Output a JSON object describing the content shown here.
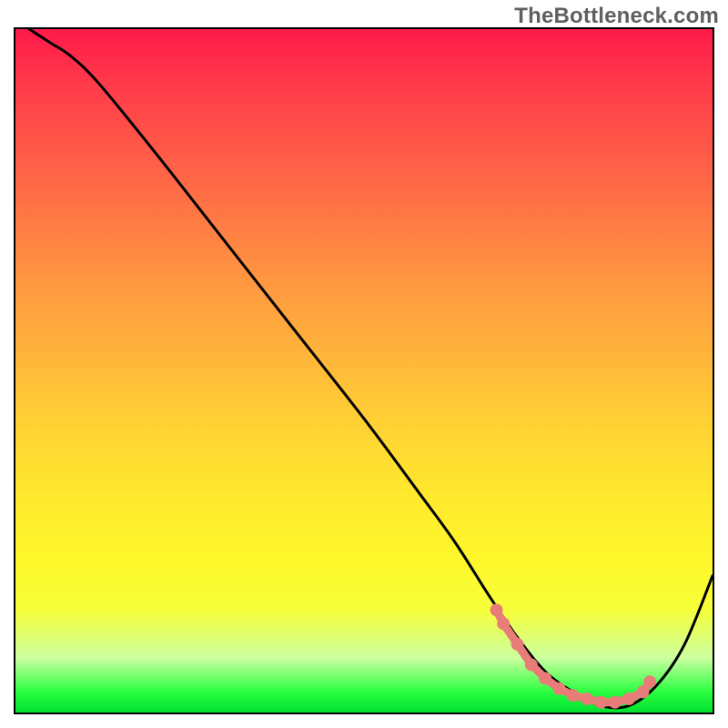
{
  "watermark": "TheBottleneck.com",
  "chart_data": {
    "type": "line",
    "title": "",
    "xlabel": "",
    "ylabel": "",
    "xlim": [
      0,
      100
    ],
    "ylim": [
      0,
      100
    ],
    "grid": false,
    "series": [
      {
        "name": "bottleneck-curve",
        "x": [
          2,
          5,
          8,
          12,
          20,
          30,
          40,
          50,
          58,
          63,
          68,
          72,
          76,
          80,
          84,
          88,
          92,
          96,
          100
        ],
        "y": [
          100,
          98,
          96,
          92,
          82,
          69,
          56,
          43,
          32,
          25,
          17,
          11,
          6,
          3,
          1,
          1,
          4,
          10,
          20
        ]
      }
    ],
    "markers": {
      "name": "highlight-points",
      "color": "#e87c78",
      "x": [
        69,
        70,
        72,
        74,
        76,
        78,
        80,
        82,
        84,
        86,
        88,
        90,
        91
      ],
      "y": [
        15,
        13,
        10,
        7,
        5,
        3.5,
        2.5,
        2,
        1.5,
        1.5,
        2,
        3,
        4.5
      ]
    },
    "background_gradient": {
      "top_color": "#ff1a4a",
      "mid_color": "#ffe82e",
      "bottom_color": "#00e030"
    }
  }
}
